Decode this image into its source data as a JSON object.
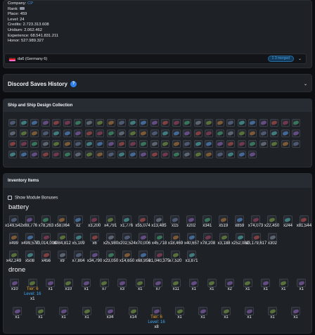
{
  "profile": {
    "company_label": "Company:",
    "company_value": "CP",
    "rank_label": "Rank:",
    "place": "Place: 459",
    "level": "Level: 24",
    "credits": "Credits: 2.723.313.608",
    "uridium": "Uridium: 2.062.462",
    "experience": "Experience: 68.541.831.211",
    "honor": "Honor: 527.989.327",
    "unit_name": "da6 (Germany 6)",
    "unit_badge": "1 3 merged",
    "colors": {
      "accent": "#2f80ed",
      "level": "#3fa9f5",
      "tier": "#f5a623"
    }
  },
  "discord": {
    "title": "Discord Saves History",
    "help_icon": "?"
  },
  "ships": {
    "title": "Ship and Ship Design Collection"
  },
  "inventory": {
    "title": "Inventory Items",
    "toggle_label": "Show Module Bonuses",
    "battery_title": "battery",
    "battery_rows": [
      [
        "x149,542",
        "x69,776",
        "x78,263",
        "x58,064",
        "x2",
        "x3,200",
        "x4,791",
        "x1,776",
        "x55,074",
        "x13,485",
        "x15",
        "x202",
        "x341",
        "x519",
        "x859",
        "x74,073",
        "x22,450",
        "x244",
        "x81,544"
      ],
      [
        "x499",
        "x499,577",
        "x3,014,009",
        "x984,812",
        "x5,109",
        "x6",
        "x25,980",
        "x202,524",
        "x70,006",
        "x45,718",
        "x18,469",
        "x40,657",
        "x78,208",
        "x3,188",
        "x252,082",
        "x3,179,617",
        "x302"
      ],
      [
        "x42,249",
        "x508",
        "x456",
        "x9",
        "x7,804",
        "x34,790",
        "x23,050",
        "x14,650",
        "x68,950",
        "x1,040,375",
        "x7,520",
        "x3,871"
      ]
    ],
    "drone_title": "drone",
    "drone_row1": [
      {
        "count": "x10"
      },
      {
        "count": "",
        "tier": "Tier: 6",
        "level": "Level: 16",
        "sub": "x1"
      },
      {
        "count": "x1"
      },
      {
        "count": "x10"
      },
      {
        "count": "x1"
      },
      {
        "count": "x7"
      },
      {
        "count": "x3"
      },
      {
        "count": "x1"
      },
      {
        "count": "x7"
      },
      {
        "count": "x11"
      },
      {
        "count": "x1"
      },
      {
        "count": "x1"
      },
      {
        "count": "x2"
      },
      {
        "count": "x1"
      },
      {
        "count": "x1"
      },
      {
        "count": "x1"
      },
      {
        "count": "x1"
      }
    ],
    "drone_row2": [
      {
        "count": "x1"
      },
      {
        "count": "x1"
      },
      {
        "count": "x1"
      },
      {
        "count": "x1"
      },
      {
        "count": "x34"
      },
      {
        "count": "x14"
      },
      {
        "count": "",
        "tier": "Tier: 6",
        "level": "Level: 16",
        "sub": "x8"
      },
      {
        "count": "x1"
      },
      {
        "count": "x1"
      },
      {
        "count": "x1"
      },
      {
        "count": "x1"
      },
      {
        "count": "x1"
      },
      {
        "count": "x1"
      }
    ]
  }
}
